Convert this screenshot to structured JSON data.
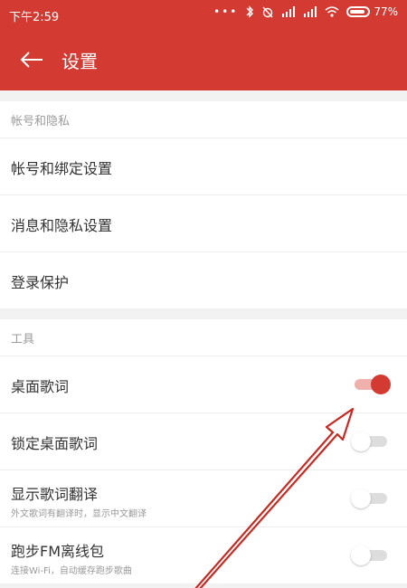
{
  "statusbar": {
    "time": "下午2:59",
    "battery": "77%"
  },
  "appbar": {
    "title": "设置"
  },
  "sections": [
    {
      "label": "帐号和隐私",
      "items": [
        {
          "label": "帐号和绑定设置"
        },
        {
          "label": "消息和隐私设置"
        },
        {
          "label": "登录保护"
        }
      ]
    },
    {
      "label": "工具",
      "items": [
        {
          "label": "桌面歌词",
          "toggle": true
        },
        {
          "label": "锁定桌面歌词",
          "toggle": false
        },
        {
          "label": "显示歌词翻译",
          "subtitle": "外文歌词有翻译时，显示中文翻译",
          "toggle": false
        },
        {
          "label": "跑步FM离线包",
          "subtitle": "连接Wi-Fi，自动缓存跑步歌曲",
          "toggle": false
        }
      ]
    }
  ],
  "colors": {
    "accent": "#d33a31",
    "accent_light": "#f0b1ad"
  }
}
